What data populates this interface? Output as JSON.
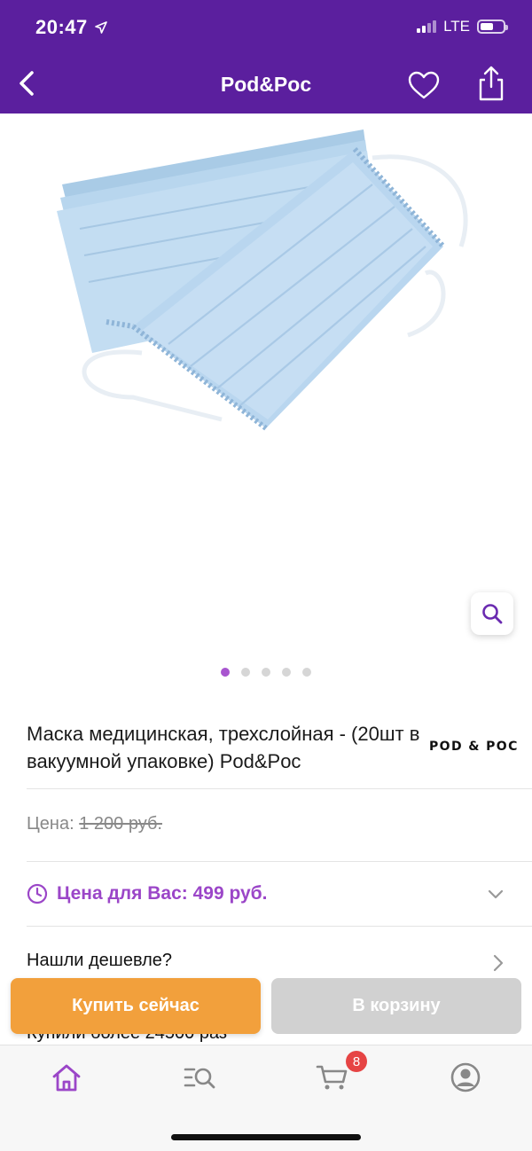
{
  "status_bar": {
    "time": "20:47",
    "network": "LTE"
  },
  "nav": {
    "title": "Pod&Poc"
  },
  "gallery": {
    "image_alt": "Blue three-layer medical face masks",
    "page_count": 5,
    "active_index": 0
  },
  "product": {
    "title": "Маска медицинская, трехслойная - (20шт в вакуумной упаковке) Pod&Poc",
    "brand_logo": "POD & POC"
  },
  "price": {
    "label": "Цена:",
    "old_value": "1 200 руб."
  },
  "promo": {
    "text": "Цена для Вас: 499 руб."
  },
  "cheaper": {
    "text": "Нашли дешевле?"
  },
  "bought": {
    "text": "Купили более 24500 раз"
  },
  "actions": {
    "buy_now": "Купить сейчас",
    "add_to_cart": "В корзину"
  },
  "tabbar": {
    "cart_count": "8"
  },
  "colors": {
    "brand": "#5b1f9e",
    "accent": "#9b46c8",
    "buy": "#f2a03c",
    "disabled": "#d1d1d1"
  }
}
